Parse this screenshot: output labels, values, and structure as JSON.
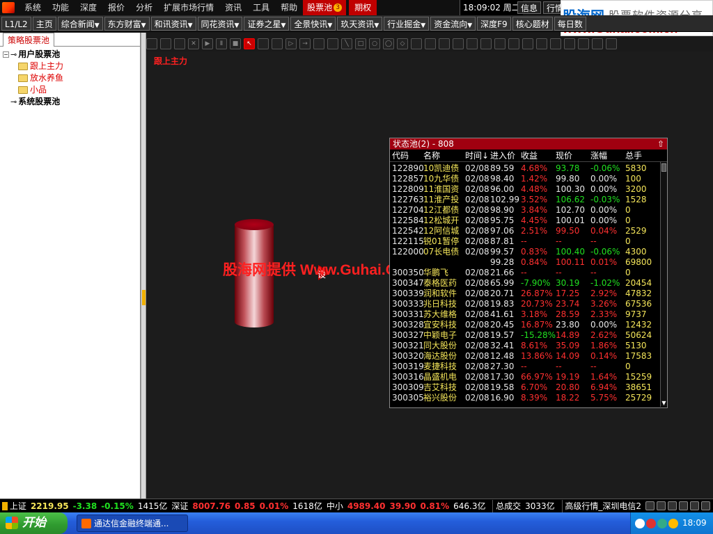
{
  "menubar": {
    "items": [
      "系统",
      "功能",
      "深度",
      "报价",
      "分析",
      "扩展市场行情",
      "资讯",
      "工具",
      "帮助"
    ],
    "pool_tab": "股票池",
    "pool_badge": "3",
    "options_tab": "期权",
    "clock": "18:09:02 周二",
    "info": "信息",
    "quote": "行情"
  },
  "watermark_top": {
    "brand": "股海网",
    "slogan": "股票软件资源分享",
    "url": "www.Guhai.com.cn"
  },
  "toolbar2": {
    "items": [
      "L1/L2",
      "主页",
      "综合新闻",
      "东方财富",
      "和讯资讯",
      "同花资讯",
      "证券之星",
      "全景快讯",
      "玖天资讯",
      "行业掘金",
      "资金流向",
      "深度F9",
      "核心题材",
      "每日数"
    ]
  },
  "left_panel": {
    "tab": "策略股票池",
    "tree": {
      "user_pool": "用户股票池",
      "children": [
        "跟上主力",
        "放水养鱼",
        "小品"
      ],
      "system_pool": "系统股票池"
    }
  },
  "canvas": {
    "title": "跟上主力",
    "center_watermark": "股海网提供 Www.Guhai.Com.CN",
    "arrow_char": "设"
  },
  "pool": {
    "title": "状态池(2) - 808",
    "headers": [
      "代码",
      "名称",
      "时间↓",
      "进入价",
      "收益",
      "现价",
      "涨幅",
      "总手"
    ],
    "rows": [
      [
        "122890",
        "10凯迪债",
        "02/08",
        "89.59",
        "4.68%",
        "93.78",
        "-0.06%",
        "5830"
      ],
      [
        "122857",
        "10九华债",
        "02/08",
        "98.40",
        "1.42%",
        "99.80",
        "0.00%",
        "100"
      ],
      [
        "122809",
        "11淮国资",
        "02/08",
        "96.00",
        "4.48%",
        "100.30",
        "0.00%",
        "3200"
      ],
      [
        "122763",
        "11淮产投",
        "02/08",
        "102.99",
        "3.52%",
        "106.62",
        "-0.03%",
        "1528"
      ],
      [
        "122704",
        "12江都债",
        "02/08",
        "98.90",
        "3.84%",
        "102.70",
        "0.00%",
        "0"
      ],
      [
        "122584",
        "12松城开",
        "02/08",
        "95.75",
        "4.45%",
        "100.01",
        "0.00%",
        "0"
      ],
      [
        "122542",
        "12阿信城",
        "02/08",
        "97.06",
        "2.51%",
        "99.50",
        "0.04%",
        "2529"
      ],
      [
        "122115",
        "锐01暂停",
        "02/08",
        "87.81",
        "--",
        "--",
        "--",
        "0"
      ],
      [
        "122000",
        "07长电债",
        "02/08",
        "99.57",
        "0.83%",
        "100.40",
        "-0.06%",
        "4300"
      ],
      [
        "",
        "",
        "",
        "99.28",
        "0.84%",
        "100.11",
        "0.01%",
        "69800"
      ],
      [
        "300350",
        "华鹏飞",
        "02/08",
        "21.66",
        "--",
        "--",
        "--",
        "0"
      ],
      [
        "300347",
        "泰格医药",
        "02/08",
        "65.99",
        "-7.90%",
        "30.19",
        "-1.02%",
        "20454"
      ],
      [
        "300339",
        "润和软件",
        "02/08",
        "20.71",
        "26.87%",
        "17.25",
        "2.92%",
        "47832"
      ],
      [
        "300333",
        "兆日科技",
        "02/08",
        "19.83",
        "20.73%",
        "23.74",
        "3.26%",
        "67536"
      ],
      [
        "300331",
        "苏大维格",
        "02/08",
        "41.61",
        "3.18%",
        "28.59",
        "2.33%",
        "9737"
      ],
      [
        "300328",
        "宜安科技",
        "02/08",
        "20.45",
        "16.87%",
        "23.80",
        "0.00%",
        "12432"
      ],
      [
        "300327",
        "中颖电子",
        "02/08",
        "19.57",
        "-15.28%",
        "14.89",
        "2.62%",
        "50624"
      ],
      [
        "300321",
        "同大股份",
        "02/08",
        "32.41",
        "8.61%",
        "35.09",
        "1.86%",
        "5130"
      ],
      [
        "300320",
        "海达股份",
        "02/08",
        "12.48",
        "13.86%",
        "14.09",
        "0.14%",
        "17583"
      ],
      [
        "300319",
        "麦捷科技",
        "02/08",
        "27.30",
        "--",
        "--",
        "--",
        "0"
      ],
      [
        "300316",
        "晶盛机电",
        "02/08",
        "17.30",
        "66.97%",
        "19.19",
        "1.64%",
        "15259"
      ],
      [
        "300309",
        "吉艾科技",
        "02/08",
        "19.58",
        "6.70%",
        "20.80",
        "6.94%",
        "38651"
      ],
      [
        "300305",
        "裕兴股份",
        "02/08",
        "16.90",
        "8.39%",
        "18.22",
        "5.75%",
        "25729"
      ]
    ]
  },
  "statusbar": {
    "sh_label": "上证",
    "sh_value": "2219.95",
    "sh_change": "-3.38",
    "sh_pct": "-0.15%",
    "sh_amount": "1415亿",
    "sz_label": "深证",
    "sz_value": "8007.76",
    "sz_change": "0.85",
    "sz_pct": "0.01%",
    "sz_amount": "1618亿",
    "zx_label": "中小",
    "zx_value": "4989.40",
    "zx_change": "39.90",
    "zx_pct": "0.81%",
    "zx_amount": "646.3亿",
    "total_label": "总成交",
    "total_value": "3033亿",
    "server": "高级行情_深圳电信2"
  },
  "taskbar": {
    "start": "开始",
    "task": "通达信金融终端通...",
    "time": "18:09"
  }
}
